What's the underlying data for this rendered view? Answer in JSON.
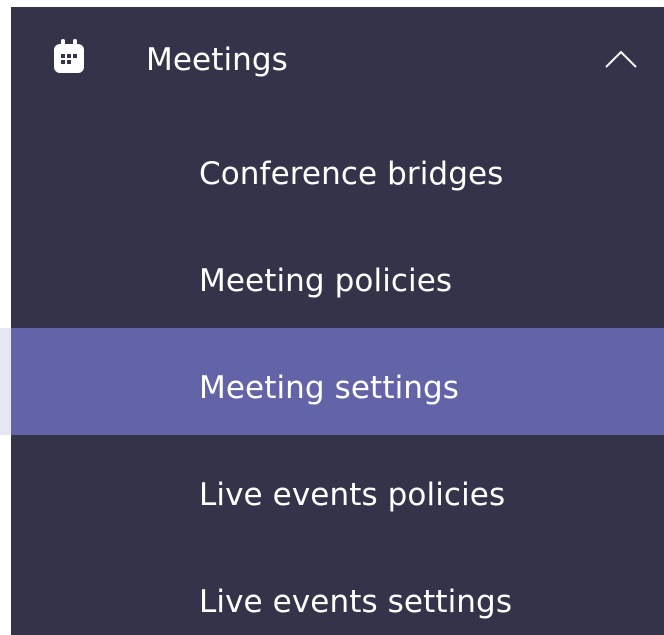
{
  "section": {
    "title": "Meetings",
    "icon": "calendar-icon",
    "expanded": true,
    "toggle_icon": "chevron-up-icon"
  },
  "nav": {
    "items": [
      {
        "label": "Conference bridges",
        "selected": false
      },
      {
        "label": "Meeting policies",
        "selected": false
      },
      {
        "label": "Meeting settings",
        "selected": true
      },
      {
        "label": "Live events policies",
        "selected": false
      },
      {
        "label": "Live events settings",
        "selected": false
      }
    ]
  },
  "colors": {
    "panel_background": "#33344a",
    "selected_background": "#6264a7",
    "selected_indicator": "#e6e7f2",
    "text": "#ffffff"
  }
}
